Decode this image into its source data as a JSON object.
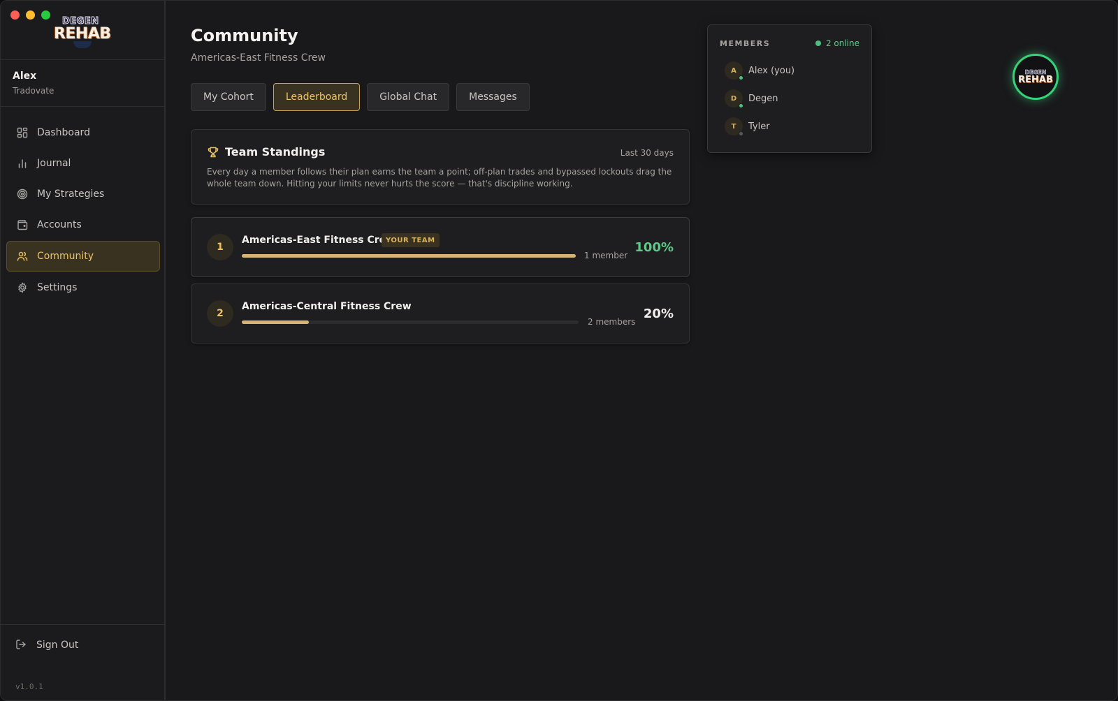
{
  "app": {
    "logo_top": "DEGEN",
    "logo_bottom": "REHAB",
    "version": "v1.0.1"
  },
  "user": {
    "name": "Alex",
    "broker": "Tradovate"
  },
  "sidebar": {
    "items": [
      {
        "label": "Dashboard",
        "icon": "dashboard-icon",
        "active": false
      },
      {
        "label": "Journal",
        "icon": "bar-chart-icon",
        "active": false
      },
      {
        "label": "My Strategies",
        "icon": "target-icon",
        "active": false
      },
      {
        "label": "Accounts",
        "icon": "wallet-icon",
        "active": false
      },
      {
        "label": "Community",
        "icon": "users-icon",
        "active": true
      },
      {
        "label": "Settings",
        "icon": "gear-icon",
        "active": false
      }
    ],
    "sign_out": "Sign Out"
  },
  "page": {
    "title": "Community",
    "subtitle": "Americas-East Fitness Crew"
  },
  "tabs": [
    {
      "label": "My Cohort",
      "active": false
    },
    {
      "label": "Leaderboard",
      "active": true
    },
    {
      "label": "Global Chat",
      "active": false
    },
    {
      "label": "Messages",
      "active": false
    }
  ],
  "standings": {
    "title": "Team Standings",
    "range": "Last 30 days",
    "description": "Every day a member follows their plan earns the team a point; off-plan trades and bypassed lockouts drag the whole team down. Hitting your limits never hurts the score — that's discipline working."
  },
  "teams": [
    {
      "rank": "1",
      "name": "Americas-East Fitness Crew",
      "badge": "YOUR TEAM",
      "members": "1 member",
      "percent": "100%",
      "progress": 1.0,
      "percent_color": "#5fc98a"
    },
    {
      "rank": "2",
      "name": "Americas-Central Fitness Crew",
      "badge": "",
      "members": "2 members",
      "percent": "20%",
      "progress": 0.2,
      "percent_color": "#f2f0ed"
    }
  ],
  "members_panel": {
    "title": "MEMBERS",
    "online": "2 online",
    "members": [
      {
        "initial": "A",
        "name": "Alex (you)",
        "online": true
      },
      {
        "initial": "D",
        "name": "Degen",
        "online": true
      },
      {
        "initial": "T",
        "name": "Tyler",
        "online": false
      }
    ]
  },
  "colors": {
    "accent": "#e9c46a",
    "online": "#4fbf7e",
    "offline": "#5a5a5d",
    "progress": "#d6b476"
  }
}
